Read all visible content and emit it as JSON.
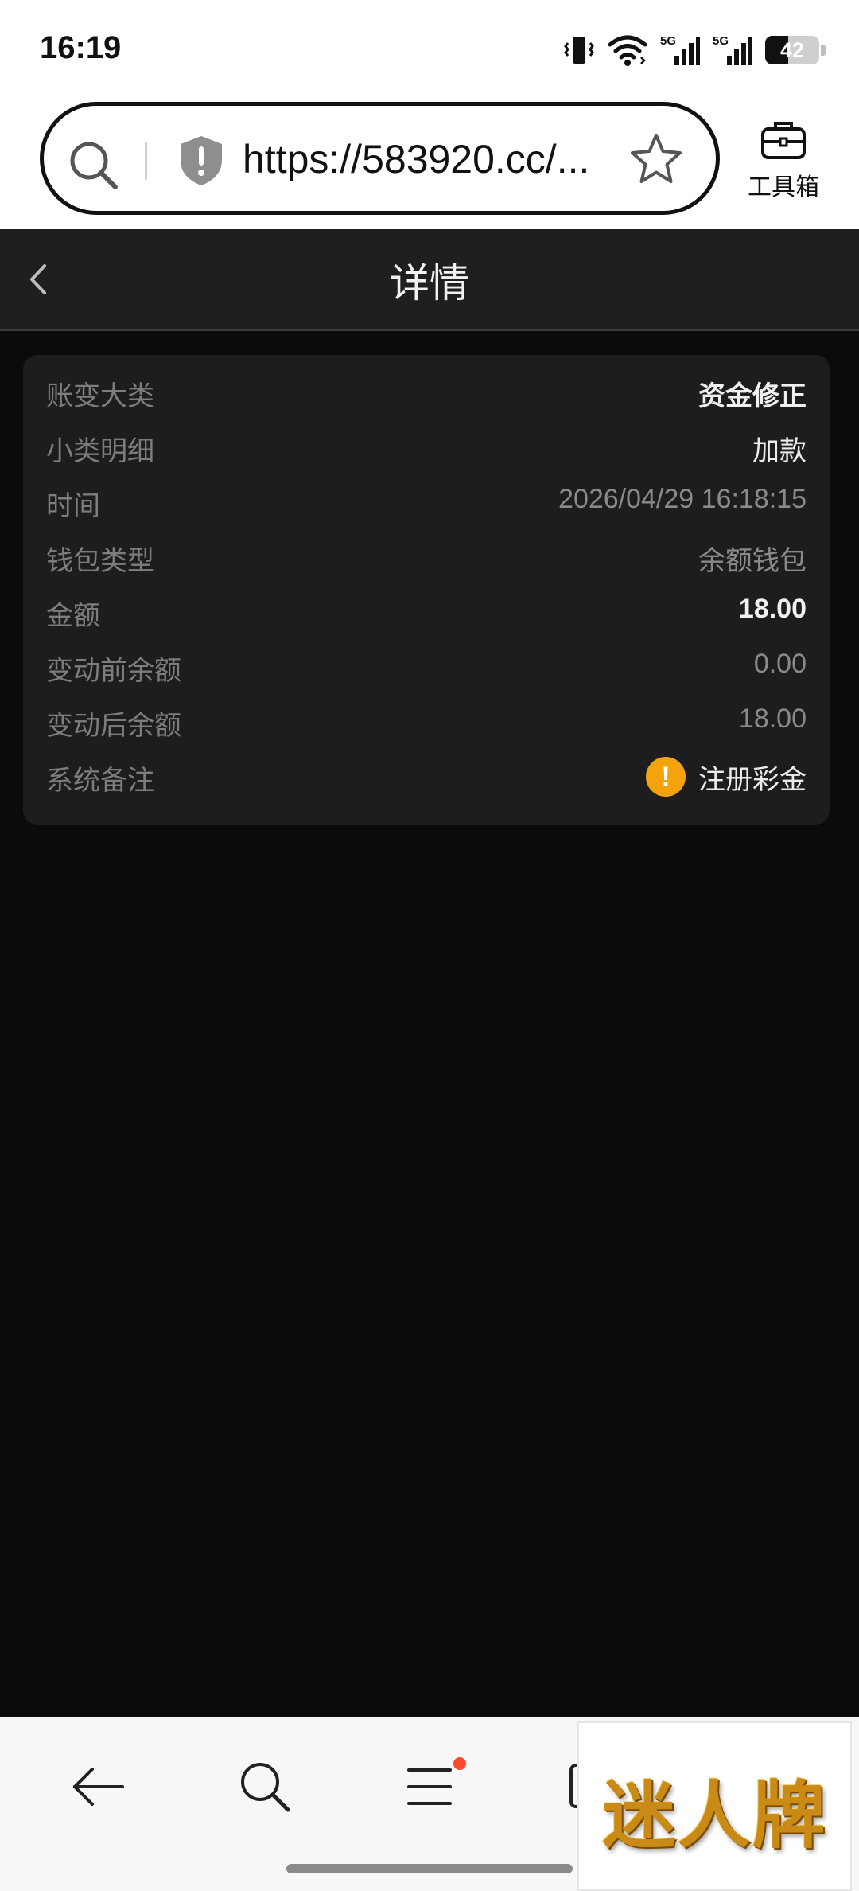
{
  "status_bar": {
    "time": "16:19",
    "network_1": "5G",
    "network_2": "5G",
    "battery_level": "42"
  },
  "browser": {
    "url": "https://583920.cc/...",
    "toolbox_label": "工具箱",
    "icons": [
      "search-icon",
      "shield-warning-icon",
      "star-icon",
      "toolbox-icon"
    ]
  },
  "header": {
    "title": "详情"
  },
  "details": [
    {
      "label": "账变大类",
      "value": "资金修正"
    },
    {
      "label": "小类明细",
      "value": "加款"
    },
    {
      "label": "时间",
      "value": "2026/04/29 16:18:15"
    },
    {
      "label": "钱包类型",
      "value": "余额钱包"
    },
    {
      "label": "金额",
      "value": "18.00"
    },
    {
      "label": "变动前余额",
      "value": "0.00"
    },
    {
      "label": "变动后余额",
      "value": "18.00"
    },
    {
      "label": "系统备注",
      "value": "注册彩金"
    }
  ],
  "bottom_nav": {
    "icons": [
      "back-arrow-icon",
      "search-icon",
      "menu-icon",
      "tabs-icon"
    ]
  },
  "ad": {
    "text": "迷人牌"
  },
  "colors": {
    "page_bg": "#0b0b0b",
    "header_bg": "#1f1f1f",
    "card_bg": "#1d1d1d",
    "warning": "#f5a30c",
    "notification_dot": "#ff4a2e"
  }
}
